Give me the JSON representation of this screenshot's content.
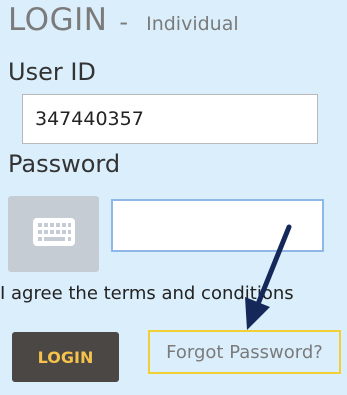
{
  "header": {
    "title": "LOGIN",
    "separator": "-",
    "subtitle": "Individual"
  },
  "form": {
    "userid_label": "User ID",
    "userid_value": "347440357",
    "password_label": "Password",
    "password_value": "",
    "terms_text": "I agree the terms and conditions",
    "login_label": "LOGIN",
    "forgot_label": "Forgot Password?"
  },
  "icons": {
    "keyboard": "keyboard-icon",
    "annotation_arrow": "arrow-icon"
  },
  "colors": {
    "background": "#dbeefb",
    "login_button_bg": "#4a4745",
    "login_button_text": "#f5c24a",
    "highlight_border": "#f1cf35",
    "arrow": "#14285a"
  }
}
